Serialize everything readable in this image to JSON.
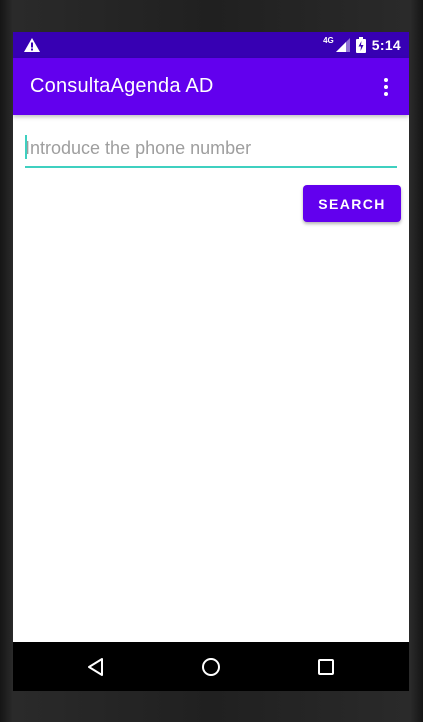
{
  "status_bar": {
    "network": "4G",
    "time": "5:14"
  },
  "app_bar": {
    "title": "ConsultaAgenda AD"
  },
  "form": {
    "phone_placeholder": "Introduce the phone number",
    "phone_value": "",
    "search_label": "SEARCH"
  },
  "colors": {
    "primary": "#6200ee",
    "primary_dark": "#3700b3",
    "accent": "#3fd0c0"
  },
  "icons": {
    "status_left": "warning-icon",
    "status_right": [
      "signal-icon",
      "battery-icon"
    ],
    "app_bar": "more-vert-icon",
    "navigation": [
      "back-icon",
      "home-icon",
      "recents-icon"
    ]
  }
}
